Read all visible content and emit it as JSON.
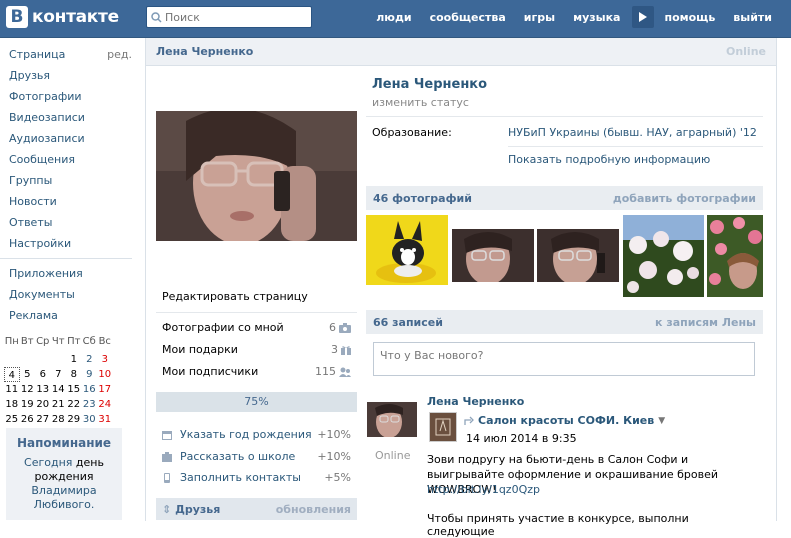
{
  "brand": {
    "logo_letter": "В",
    "logo_text": "контакте"
  },
  "search": {
    "placeholder": "Поиск"
  },
  "topnav": [
    "люди",
    "сообщества",
    "игры",
    "музыка",
    "помощь",
    "выйти"
  ],
  "leftmenu": {
    "page": "Страница",
    "edit": "ред.",
    "items": [
      "Друзья",
      "Фотографии",
      "Видеозаписи",
      "Аудиозаписи",
      "Сообщения",
      "Группы",
      "Новости",
      "Ответы",
      "Настройки"
    ],
    "items2": [
      "Приложения",
      "Документы",
      "Реклама"
    ]
  },
  "calendar": {
    "days": [
      "Пн",
      "Вт",
      "Ср",
      "Чт",
      "Пт",
      "Сб",
      "Вс"
    ],
    "weeks": [
      [
        "",
        "",
        "",
        "",
        "1",
        "2",
        "3"
      ],
      [
        "4",
        "5",
        "6",
        "7",
        "8",
        "9",
        "10"
      ],
      [
        "11",
        "12",
        "13",
        "14",
        "15",
        "16",
        "17"
      ],
      [
        "18",
        "19",
        "20",
        "21",
        "22",
        "23",
        "24"
      ],
      [
        "25",
        "26",
        "27",
        "28",
        "29",
        "30",
        "31"
      ]
    ]
  },
  "reminder": {
    "title": "Напоминание",
    "today": "Сегодня",
    "text1": "день",
    "text2": "рождения",
    "person": "Владимира Любивого."
  },
  "profile": {
    "header_name": "Лена Черненко",
    "online": "Online",
    "name": "Лена Черненко",
    "change_status": "изменить статус",
    "edu_label": "Образование:",
    "edu_value": "НУБиП Украины (бывш. НАУ, аграрный) '12",
    "more_info": "Показать подробную информацию",
    "edit_page": "Редактировать страницу"
  },
  "stats": [
    {
      "label": "Фотографии со мной",
      "count": "6"
    },
    {
      "label": "Мои подарки",
      "count": "3"
    },
    {
      "label": "Мои подписчики",
      "count": "115"
    }
  ],
  "progress": {
    "label": "75%",
    "value": 75
  },
  "tasks": [
    {
      "label": "Указать год рождения",
      "value": "+10%"
    },
    {
      "label": "Рассказать о школе",
      "value": "+10%"
    },
    {
      "label": "Заполнить контакты",
      "value": "+5%"
    }
  ],
  "friends": {
    "title": "Друзья",
    "updates": "обновления"
  },
  "photos": {
    "title": "46 фотографий",
    "add": "добавить фотографии"
  },
  "wall": {
    "title": "66 записей",
    "to_posts": "к записям Лены",
    "input_placeholder": "Что у Вас нового?"
  },
  "post": {
    "author": "Лена Черненко",
    "online": "Online",
    "repost_name": "Салон красоты СОФИ. Киев",
    "repost_date": "14 июл 2014 в 9:35",
    "text": "Зови подругу на бьюти-день в Салон Софи и выигрывайте оформление и окрашивание бровей WOWBROW!",
    "link": "http://bit.ly/1qz0Qzp",
    "text2": "Чтобы принять участие в конкурсе, выполни следующие"
  },
  "colors": {
    "header": "#3d6898",
    "link": "#2b587a",
    "panel": "#e9edf1"
  }
}
